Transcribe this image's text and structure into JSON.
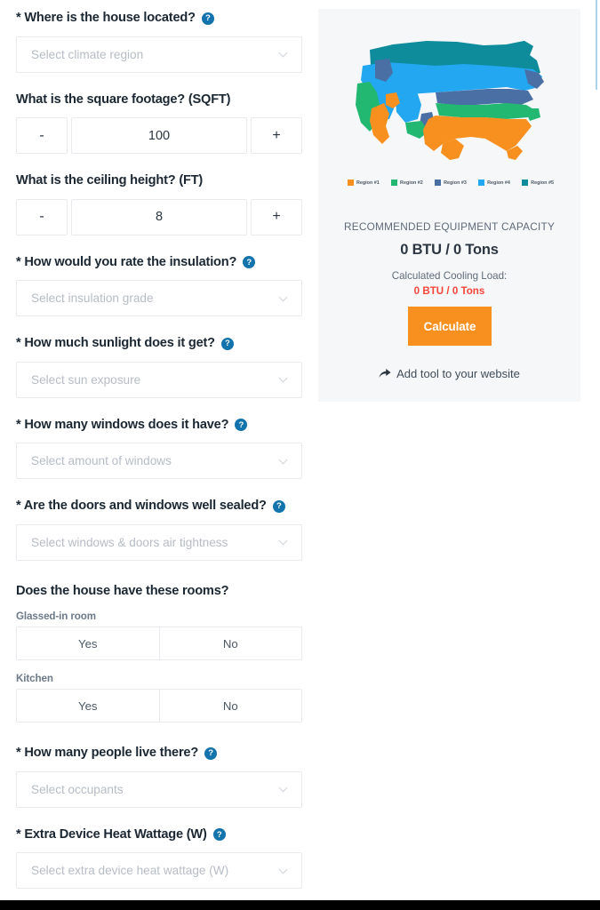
{
  "form": {
    "fields": [
      {
        "id": "climate-region",
        "label": "* Where is the house located?",
        "help": "?",
        "type": "select",
        "placeholder": "Select climate region"
      },
      {
        "id": "square-footage",
        "label": "What is the square footage? (SQFT)",
        "type": "stepper",
        "minus": "-",
        "plus": "+",
        "value": "100"
      },
      {
        "id": "ceiling-height",
        "label": "What is the ceiling height? (FT)",
        "type": "stepper",
        "minus": "-",
        "plus": "+",
        "value": "8"
      },
      {
        "id": "insulation-grade",
        "label": "* How would you rate the insulation?",
        "help": "?",
        "type": "select",
        "placeholder": "Select insulation grade"
      },
      {
        "id": "sun-exposure",
        "label": "* How much sunlight does it get?",
        "help": "?",
        "type": "select",
        "placeholder": "Select sun exposure"
      },
      {
        "id": "windows-amount",
        "label": "* How many windows does it have?",
        "help": "?",
        "type": "select",
        "placeholder": "Select amount of windows"
      },
      {
        "id": "air-tightness",
        "label": "* Are the doors and windows well sealed?",
        "help": "?",
        "type": "select",
        "placeholder": "Select windows & doors air tightness"
      }
    ],
    "rooms": {
      "heading": "Does the house have these rooms?",
      "items": [
        {
          "id": "glassed-in-room",
          "label": "Glassed-in room",
          "yes": "Yes",
          "no": "No"
        },
        {
          "id": "kitchen",
          "label": "Kitchen",
          "yes": "Yes",
          "no": "No"
        }
      ]
    },
    "fields_tail": [
      {
        "id": "occupants",
        "label": "* How many people live there?",
        "help": "?",
        "type": "select",
        "placeholder": "Select occupants"
      },
      {
        "id": "extra-device-wattage",
        "label": "* Extra Device Heat Wattage (W)",
        "help": "?",
        "type": "select",
        "placeholder": "Select extra device heat wattage (W)"
      }
    ]
  },
  "panel": {
    "map": {
      "alt": "us-climate-region-map",
      "legend": [
        {
          "label": "Region #1",
          "color": "#f7901e"
        },
        {
          "label": "Region #2",
          "color": "#23b872"
        },
        {
          "label": "Region #3",
          "color": "#4a6fa5"
        },
        {
          "label": "Region #4",
          "color": "#22a7f0"
        },
        {
          "label": "Region #5",
          "color": "#0e8c9b"
        }
      ]
    },
    "results": {
      "title": "RECOMMENDED EQUIPMENT CAPACITY",
      "capacity": "0 BTU / 0 Tons",
      "load_label": "Calculated Cooling Load:",
      "load_value": "0 BTU / 0 Tons",
      "load_color": "#f5453a"
    },
    "calculate_label": "Calculate",
    "calculate_color": "#f7901e",
    "add_tool_label": "Add tool to your website"
  }
}
